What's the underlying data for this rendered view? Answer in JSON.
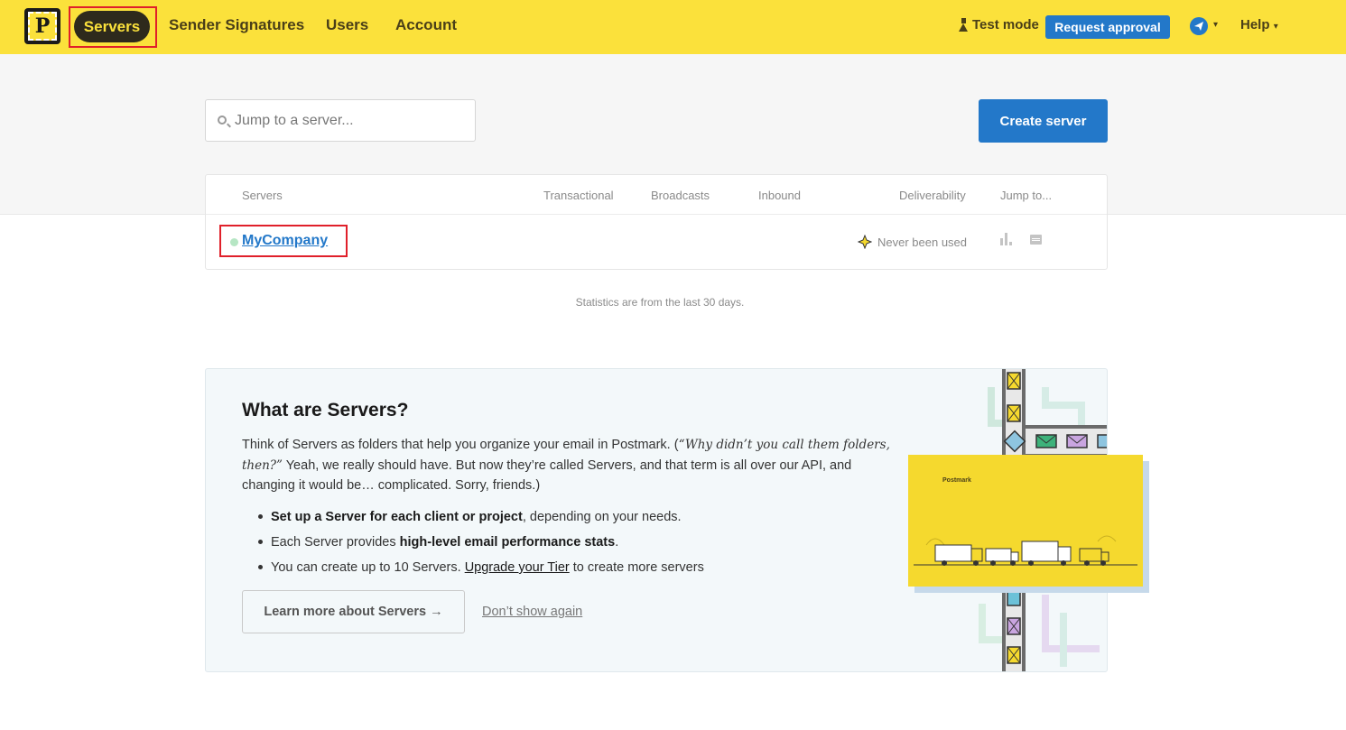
{
  "nav": {
    "logo_letter": "P",
    "servers": "Servers",
    "sender_signatures": "Sender Signatures",
    "users": "Users",
    "account": "Account",
    "test_mode": "Test mode",
    "request_approval": "Request approval",
    "help": "Help",
    "help_caret": "▾",
    "avatar_caret": "▾"
  },
  "toolbar": {
    "search_placeholder": "Jump to a server...",
    "create_server": "Create server"
  },
  "table": {
    "headers": {
      "servers": "Servers",
      "transactional": "Transactional",
      "broadcasts": "Broadcasts",
      "inbound": "Inbound",
      "deliverability": "Deliverability",
      "jump_to": "Jump to..."
    },
    "rows": [
      {
        "name": "MyCompany",
        "status_color": "#b6e6c4",
        "deliverability": "Never been used"
      }
    ]
  },
  "stats_note": "Statistics are from the last 30 days.",
  "info": {
    "title": "What are Servers?",
    "para_1": "Think of Servers as folders that help you organize your email in Postmark. (",
    "para_quote": "“Why didn’t you call them folders, then?”",
    "para_2": " Yeah, we really should have. But now they’re called Servers, and that term is all over our API, and changing it would be… complicated. Sorry, friends.)",
    "bullet_1_bold": "Set up a Server for each client or project",
    "bullet_1_rest": ", depending on your needs.",
    "bullet_2_pre": "Each Server provides ",
    "bullet_2_bold": "high-level email performance stats",
    "bullet_2_post": ".",
    "bullet_3_pre": "You can create up to 10 Servers. ",
    "bullet_3_link": "Upgrade your Tier",
    "bullet_3_post": " to create more servers",
    "learn_more": "Learn more about Servers →",
    "dont_show": "Don’t show again",
    "promo_label": "Postmark"
  },
  "colors": {
    "brand_yellow": "#fbe13b",
    "primary_blue": "#2378c9",
    "highlight_red": "#e0202a"
  }
}
